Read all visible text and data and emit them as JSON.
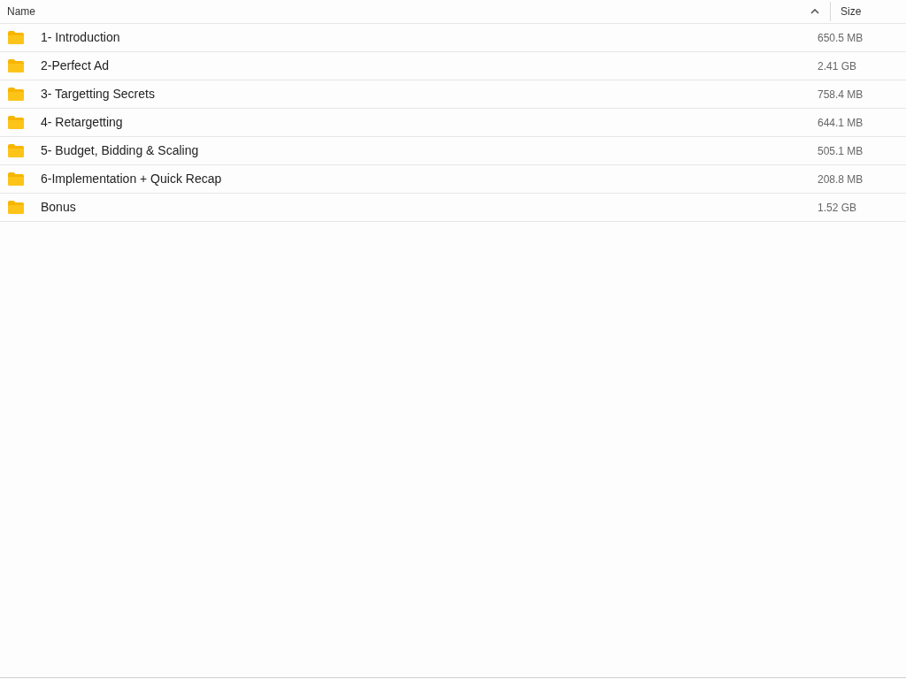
{
  "table": {
    "columns": [
      {
        "label": "Name",
        "sort_ascending": true
      },
      {
        "label": "Size"
      }
    ],
    "rows": [
      {
        "kind": "folder",
        "name": "1- Introduction",
        "size": "650.5 MB"
      },
      {
        "kind": "folder",
        "name": "2-Perfect Ad",
        "size": "2.41 GB"
      },
      {
        "kind": "folder",
        "name": "3- Targetting Secrets",
        "size": "758.4 MB"
      },
      {
        "kind": "folder",
        "name": "4- Retargetting",
        "size": "644.1 MB"
      },
      {
        "kind": "folder",
        "name": "5- Budget, Bidding & Scaling",
        "size": "505.1 MB"
      },
      {
        "kind": "folder",
        "name": "6-Implementation + Quick Recap",
        "size": "208.8 MB"
      },
      {
        "kind": "folder",
        "name": "Bonus",
        "size": "1.52 GB"
      }
    ]
  }
}
